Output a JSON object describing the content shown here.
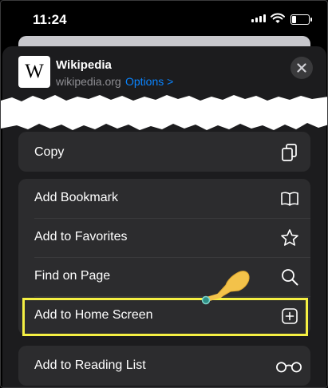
{
  "status_bar": {
    "time": "11:24"
  },
  "header": {
    "logo_text": "W",
    "site_title": "Wikipedia",
    "site_url": "wikipedia.org",
    "options_label": "Options >"
  },
  "actions": {
    "copy": {
      "label": "Copy",
      "icon": "copy-icon"
    },
    "items": [
      {
        "label": "Add Bookmark",
        "icon": "book-icon"
      },
      {
        "label": "Add to Favorites",
        "icon": "star-icon"
      },
      {
        "label": "Find on Page",
        "icon": "magnifier-icon"
      },
      {
        "label": "Add to Home Screen",
        "icon": "plus-square-icon"
      }
    ],
    "reading_list": {
      "label": "Add to Reading List",
      "icon": "glasses-icon"
    }
  },
  "colors": {
    "accent": "#0a84ff",
    "highlight": "#f5f043",
    "pointer": "#f3c24a",
    "sheet": "#1c1c1e",
    "row": "#2c2c2e"
  }
}
